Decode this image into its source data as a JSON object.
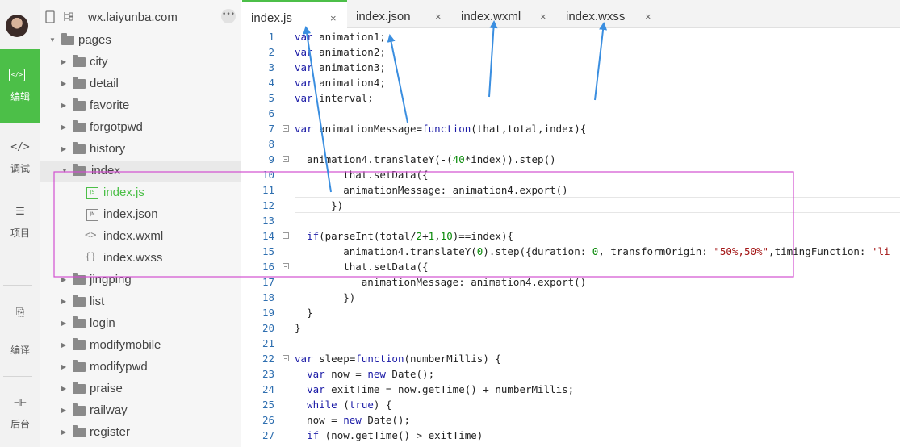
{
  "activity_bar": {
    "items": [
      {
        "label": "编辑",
        "glyph": "</>"
      },
      {
        "label": "调试",
        "glyph": "</>"
      },
      {
        "label": "项目",
        "glyph": "☰"
      },
      {
        "label": "编译",
        "glyph": "⎘"
      },
      {
        "label": "后台",
        "glyph": "⊣⊢"
      }
    ]
  },
  "file_tree": {
    "project_title": "wx.laiyunba.com",
    "more_glyph": "•••",
    "root": "pages",
    "folders_before": [
      "city",
      "detail",
      "favorite",
      "forgotpwd",
      "history"
    ],
    "open_folder": "index",
    "files": [
      {
        "name": "index.js",
        "badge": "JS"
      },
      {
        "name": "index.json",
        "badge": "JN"
      },
      {
        "name": "index.wxml",
        "badge": "<>"
      },
      {
        "name": "index.wxss",
        "badge": "{}"
      }
    ],
    "folders_after": [
      "jingping",
      "list",
      "login",
      "modifymobile",
      "modifypwd",
      "praise",
      "railway",
      "register"
    ]
  },
  "tabs": [
    {
      "name": "index.js",
      "close": "×"
    },
    {
      "name": "index.json",
      "close": "×"
    },
    {
      "name": "index.wxml",
      "close": "×"
    },
    {
      "name": "index.wxss",
      "close": "×"
    }
  ],
  "code_lines": [
    {
      "n": "1",
      "text": "var animation1;"
    },
    {
      "n": "2",
      "text": "var animation2;"
    },
    {
      "n": "3",
      "text": "var animation3;"
    },
    {
      "n": "4",
      "text": "var animation4;"
    },
    {
      "n": "5",
      "text": "var interval;"
    },
    {
      "n": "6",
      "text": ""
    },
    {
      "n": "7",
      "text": "var animationMessage=function(that,total,index){"
    },
    {
      "n": "8",
      "text": ""
    },
    {
      "n": "9",
      "text": "  animation4.translateY(-(40*index)).step()"
    },
    {
      "n": "10",
      "text": "        that.setData({"
    },
    {
      "n": "11",
      "text": "        animationMessage: animation4.export()"
    },
    {
      "n": "12",
      "text": "      })"
    },
    {
      "n": "13",
      "text": ""
    },
    {
      "n": "14",
      "text": "  if(parseInt(total/2+1,10)==index){"
    },
    {
      "n": "15",
      "text": "        animation4.translateY(0).step({duration: 0, transformOrigin: \"50%,50%\",timingFunction: 'li"
    },
    {
      "n": "16",
      "text": "        that.setData({"
    },
    {
      "n": "17",
      "text": "           animationMessage: animation4.export()"
    },
    {
      "n": "18",
      "text": "        })"
    },
    {
      "n": "19",
      "text": "  }"
    },
    {
      "n": "20",
      "text": "}"
    },
    {
      "n": "21",
      "text": ""
    },
    {
      "n": "22",
      "text": "var sleep=function(numberMillis) {"
    },
    {
      "n": "23",
      "text": "  var now = new Date();"
    },
    {
      "n": "24",
      "text": "  var exitTime = now.getTime() + numberMillis;"
    },
    {
      "n": "25",
      "text": "  while (true) {"
    },
    {
      "n": "26",
      "text": "  now = new Date();"
    },
    {
      "n": "27",
      "text": "  if (now.getTime() > exitTime)"
    }
  ],
  "colors": {
    "accent": "#4cbf48",
    "annotation_arrow": "#3a8ee0",
    "highlight_box": "#d24fd0"
  }
}
